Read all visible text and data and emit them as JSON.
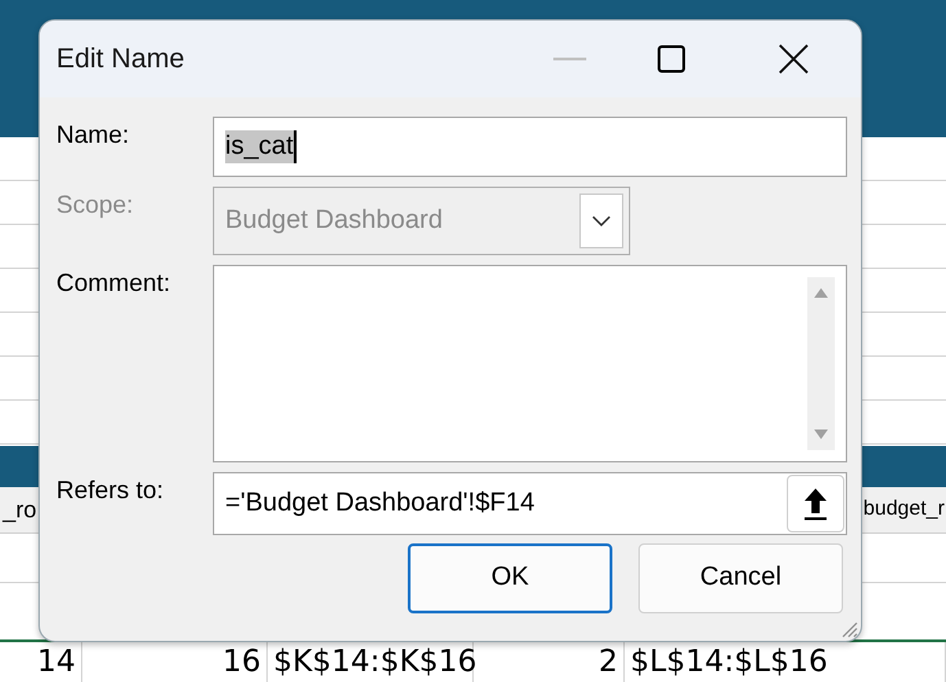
{
  "spreadsheet": {
    "header_cells": [
      "_ro",
      "budget_r"
    ],
    "row": [
      "14",
      "16",
      "$K$14:$K$16",
      "2",
      "$L$14:$L$16"
    ]
  },
  "dialog": {
    "title": "Edit Name",
    "fields": [
      {
        "kind": "text",
        "label": "Name:",
        "value": "is_cat",
        "selected": true
      },
      {
        "kind": "select",
        "label": "Scope:",
        "value": "Budget Dashboard",
        "disabled": true
      },
      {
        "kind": "memo",
        "label": "Comment:"
      },
      {
        "kind": "ref",
        "label": "Refers to:",
        "value": "='Budget Dashboard'!$F14"
      }
    ],
    "buttons": [
      {
        "label": "OK",
        "selected": true
      },
      {
        "label": "Cancel",
        "selected": false
      }
    ]
  }
}
